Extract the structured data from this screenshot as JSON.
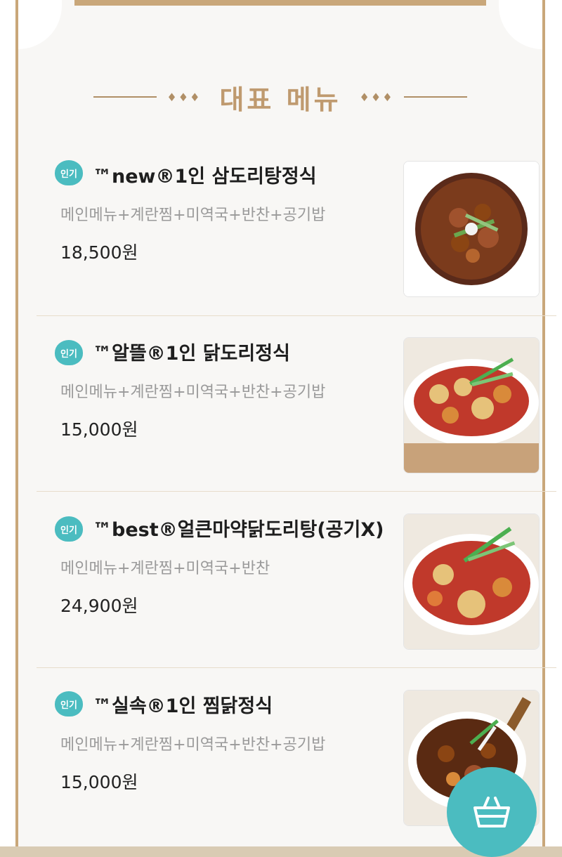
{
  "section": {
    "title": "대표 메뉴",
    "left_deco": "♦♦♦",
    "right_deco": "♦♦♦"
  },
  "menu": [
    {
      "badge": "인기",
      "name": "™new®1인 삼도리탕정식",
      "desc": "메인메뉴+계란찜+미역국+반찬+공기밥",
      "price": "18,500원",
      "image": "spicy-braised-chicken-bowl"
    },
    {
      "badge": "인기",
      "name": "™알뜰®1인 닭도리정식",
      "desc": "메인메뉴+계란찜+미역국+반찬+공기밥",
      "price": "15,000원",
      "image": "dakdoritang-with-dumplings-plate"
    },
    {
      "badge": "인기",
      "name": "™best®얼큰마약닭도리탕(공기X)",
      "desc": "메인메뉴+계란찜+미역국+반찬",
      "price": "24,900원",
      "image": "spicy-chicken-stew-plate"
    },
    {
      "badge": "인기",
      "name": "™실속®1인 찜닭정식",
      "desc": "메인메뉴+계란찜+미역국+반찬+공기밥",
      "price": "15,000원",
      "image": "jjimdak-plate"
    }
  ],
  "cart": {
    "icon": "basket-icon"
  },
  "colors": {
    "accent": "#4bbcc0",
    "gold": "#c9a77a",
    "title": "#bf9a6f"
  }
}
